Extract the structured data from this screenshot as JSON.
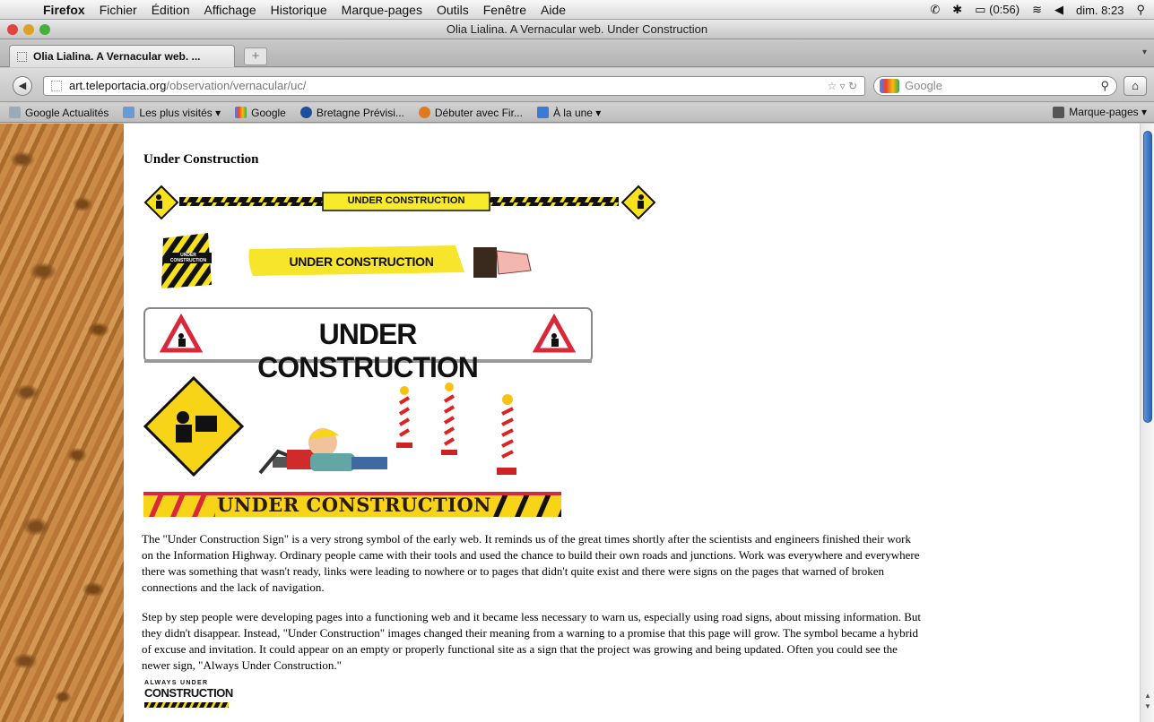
{
  "menubar": {
    "app": "Firefox",
    "items": [
      "Fichier",
      "Édition",
      "Affichage",
      "Historique",
      "Marque-pages",
      "Outils",
      "Fenêtre",
      "Aide"
    ],
    "battery": "(0:56)",
    "clock": "dim. 8:23"
  },
  "window": {
    "title": "Olia Lialina. A Vernacular web. Under Construction"
  },
  "tab": {
    "label": "Olia Lialina. A Vernacular web. ...",
    "new_tab": "+"
  },
  "navigation": {
    "url_domain": "art.teleportacia.org",
    "url_path": "/observation/vernacular/uc/",
    "search_placeholder": "Google"
  },
  "bookmarks": {
    "items": [
      "Google Actualités",
      "Les plus visités ▾",
      "Google",
      "Bretagne Prévisi...",
      "Débuter avec Fir...",
      "À la une ▾"
    ],
    "right": "Marque-pages ▾"
  },
  "page": {
    "heading": "Under Construction",
    "sign1_text": "UNDER CONSTRUCTION",
    "sign2_text": "UNDER CONSTRUCTION",
    "sign2_small": "UNDER CONSTRUCTION",
    "sign3_text": "UNDER CONSTRUCTION",
    "sign5_text": "UNDER CONSTRUCTION",
    "sign6_line1": "ALWAYS UNDER",
    "sign6_line2": "CONSTRUCTION",
    "paragraph1": "The \"Under Construction Sign\" is a very strong symbol of the early web. It reminds us of the great times shortly after the scientists and engineers finished their work on the Information Highway. Ordinary people came with their tools and used the chance to build their own roads and junctions. Work was everywhere and everywhere there was something that wasn't ready, links were leading to nowhere or to pages that didn't quite exist and there were signs on the pages that warned of broken connections and the lack of navigation.",
    "paragraph2": "Step by step people were developing pages into a functioning web and it became less necessary to warn us, especially using road signs, about missing information. But they didn't disappear. Instead, \"Under Construction\" images changed their meaning from a warning to a promise that this page will grow. The symbol became a hybrid of excuse and invitation. It could appear on an empty or properly functional site as a sign that the project was growing and being updated. Often you could see the newer sign, \"Always Under Construction.\""
  }
}
